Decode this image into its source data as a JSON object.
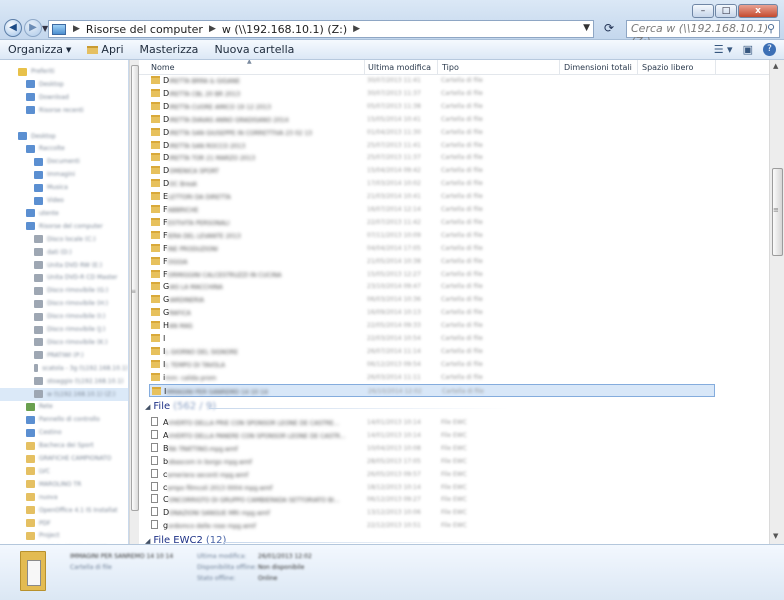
{
  "window": {
    "controls": [
      "–",
      "□",
      "x"
    ]
  },
  "address": {
    "crumbs": [
      "Risorse del computer",
      "w (\\\\192.168.10.1) (Z:)"
    ]
  },
  "search": {
    "placeholder": "Cerca w (\\\\192.168.10.1) (Z:)"
  },
  "toolbar": {
    "organize": "Organizza",
    "open": "Apri",
    "burn": "Masterizza",
    "new_folder": "Nuova cartella"
  },
  "columns": {
    "name": "Nome",
    "modified": "Ultima modifica",
    "type": "Tipo",
    "total_size": "Dimensioni totali",
    "free_space": "Spazio libero"
  },
  "navpane": {
    "items": [
      {
        "label": "Preferiti",
        "icon": "star-icon",
        "indent": 0
      },
      {
        "label": "Desktop",
        "icon": "desktop-icon",
        "indent": 1
      },
      {
        "label": "Download",
        "icon": "download-icon",
        "indent": 1
      },
      {
        "label": "Risorse recenti",
        "icon": "recent-icon",
        "indent": 1
      },
      {
        "label": "",
        "icon": "",
        "indent": 0
      },
      {
        "label": "Desktop",
        "icon": "desktop-icon",
        "indent": 0
      },
      {
        "label": "Raccolte",
        "icon": "library-icon",
        "indent": 1
      },
      {
        "label": "Documenti",
        "icon": "documents-icon",
        "indent": 2
      },
      {
        "label": "Immagini",
        "icon": "pictures-icon",
        "indent": 2
      },
      {
        "label": "Musica",
        "icon": "music-icon",
        "indent": 2
      },
      {
        "label": "Video",
        "icon": "video-icon",
        "indent": 2
      },
      {
        "label": "utente",
        "icon": "user-icon",
        "indent": 1
      },
      {
        "label": "Risorse del computer",
        "icon": "computer-icon",
        "indent": 1
      },
      {
        "label": "Disco locale (C:)",
        "icon": "drive-icon",
        "indent": 2
      },
      {
        "label": "dati (D:)",
        "icon": "drive-icon",
        "indent": 2
      },
      {
        "label": "Unita DVD RW (E:)",
        "icon": "drive-icon",
        "indent": 2
      },
      {
        "label": "Unita DVD-R CD Master",
        "icon": "drive-icon",
        "indent": 2
      },
      {
        "label": "Disco rimovibile (G:)",
        "icon": "drive-icon",
        "indent": 2
      },
      {
        "label": "Disco rimovibile (H:)",
        "icon": "drive-icon",
        "indent": 2
      },
      {
        "label": "Disco rimovibile (I:)",
        "icon": "drive-icon",
        "indent": 2
      },
      {
        "label": "Disco rimovibile (J:)",
        "icon": "drive-icon",
        "indent": 2
      },
      {
        "label": "Disco rimovibile (K:)",
        "icon": "drive-icon",
        "indent": 2
      },
      {
        "label": "PRATIWI (P:)",
        "icon": "drive-icon",
        "indent": 2
      },
      {
        "label": "scatola - 3g (\\\\192.168.10.1)",
        "icon": "net-drive-icon",
        "indent": 2
      },
      {
        "label": "stoaggio (\\\\192.168.10.1)",
        "icon": "net-drive-icon",
        "indent": 2
      },
      {
        "label": "w (\\\\192.168.10.1) (Z:)",
        "icon": "net-drive-icon",
        "indent": 2,
        "selected": true
      },
      {
        "label": "Rete",
        "icon": "network-icon",
        "indent": 1
      },
      {
        "label": "Pannello di controllo",
        "icon": "control-panel-icon",
        "indent": 1
      },
      {
        "label": "Cestino",
        "icon": "recycle-bin-icon",
        "indent": 1
      },
      {
        "label": "Bacheca dei Sport",
        "icon": "folder-icon",
        "indent": 1
      },
      {
        "label": "GRAFICHE CAMPIONATO",
        "icon": "folder-icon",
        "indent": 1
      },
      {
        "label": "LVC",
        "icon": "folder-icon",
        "indent": 1
      },
      {
        "label": "MAROLINO TR",
        "icon": "folder-icon",
        "indent": 1
      },
      {
        "label": "nuova",
        "icon": "folder-icon",
        "indent": 1
      },
      {
        "label": "OpenOffice 4.1 IS Installat",
        "icon": "folder-icon",
        "indent": 1
      },
      {
        "label": "PDF",
        "icon": "folder-icon",
        "indent": 1
      },
      {
        "label": "Project",
        "icon": "folder-icon",
        "indent": 1
      },
      {
        "label": "SEGNALAZIONI CORSE",
        "icon": "folder-icon",
        "indent": 1
      }
    ]
  },
  "folders": [
    {
      "first": "D",
      "rest": "IRETTA BRRA & GIGANE",
      "date": "30/07/2013 11:41",
      "type": "Cartella di file"
    },
    {
      "first": "D",
      "rest": "IRETTA CBL 20 BR 2013",
      "date": "30/07/2013 11:37",
      "type": "Cartella di file"
    },
    {
      "first": "D",
      "rest": "IRETTA CUORE AMICO 19 12 2013",
      "date": "05/07/2013 11:38",
      "type": "Cartella di file"
    },
    {
      "first": "D",
      "rest": "IRETTA DIAVAS ANNO GRADISANO 2014",
      "date": "15/05/2014 10:41",
      "type": "Cartella di file"
    },
    {
      "first": "D",
      "rest": "IRETTA SAN GIUSEPPE IN CORRETTIVA 23 02 13",
      "date": "01/04/2013 11:30",
      "type": "Cartella di file"
    },
    {
      "first": "D",
      "rest": "IRETTA SAN ROCCO 2013",
      "date": "25/07/2013 11:41",
      "type": "Cartella di file"
    },
    {
      "first": "D",
      "rest": "IRETTA TOR 21 MARZO 2013",
      "date": "25/07/2013 11:37",
      "type": "Cartella di file"
    },
    {
      "first": "D",
      "rest": "OMENICA SPORT",
      "date": "15/04/2014 09:42",
      "type": "Cartella di file"
    },
    {
      "first": "D",
      "rest": "OC Break",
      "date": "17/03/2014 10:02",
      "type": "Cartella di file"
    },
    {
      "first": "E",
      "rest": "LETTORI DA DIRETTA",
      "date": "21/03/2014 10:41",
      "type": "Cartella di file"
    },
    {
      "first": "F",
      "rest": "ABBRICHE",
      "date": "16/07/2014 12:14",
      "type": "Cartella di file"
    },
    {
      "first": "F",
      "rest": "ESTIVITA PERSONALI",
      "date": "22/07/2013 11:42",
      "type": "Cartella di file"
    },
    {
      "first": "F",
      "rest": "IERA DEL LEVANTE 2013",
      "date": "07/11/2013 10:09",
      "type": "Cartella di file"
    },
    {
      "first": "F",
      "rest": "INE PRODUZIONI",
      "date": "04/04/2014 17:05",
      "type": "Cartella di file"
    },
    {
      "first": "F",
      "rest": "OGGIA",
      "date": "21/05/2014 10:38",
      "type": "Cartella di file"
    },
    {
      "first": "F",
      "rest": "ORMIGGINI CALCESTRUZZI IN CUCINA",
      "date": "15/05/2013 12:27",
      "type": "Cartella di file"
    },
    {
      "first": "G",
      "rest": "IAS LA MACCHINA",
      "date": "23/10/2014 09:47",
      "type": "Cartella di file"
    },
    {
      "first": "G",
      "rest": "IARDINERIA",
      "date": "06/03/2014 10:36",
      "type": "Cartella di file"
    },
    {
      "first": "G",
      "rest": "RAFICA",
      "date": "16/09/2014 10:13",
      "type": "Cartella di file"
    },
    {
      "first": "H",
      "rest": "AN MAS",
      "date": "22/05/2014 09:33",
      "type": "Cartella di file"
    },
    {
      "first": "I",
      "rest": "",
      "date": "22/03/2014 10:54",
      "type": "Cartella di file"
    },
    {
      "first": "I",
      "rest": "L GIORNO DEL SIGNORE",
      "date": "26/07/2014 11:14",
      "type": "Cartella di file"
    },
    {
      "first": "I",
      "rest": "L TEMPO DI TAVOLA",
      "date": "06/12/2013 09:54",
      "type": "Cartella di file"
    },
    {
      "first": "i",
      "rest": "mm: calida prom",
      "date": "26/03/2014 11:11",
      "type": "Cartella di file"
    },
    {
      "first": "I",
      "rest": "MMAGINI PER SANREMO 14 10 14",
      "date": "26/10/2014 12:02",
      "type": "Cartella di file",
      "selected": true
    }
  ],
  "group_file": {
    "label": "File",
    "count": "(562 / 9)"
  },
  "files": [
    {
      "first": "A",
      "rest": "VVERTO DELLA PRIE CON SPONSOR LEONE DE CASTRE...",
      "date": "14/01/2013 10:14",
      "type": "File EWC"
    },
    {
      "first": "A",
      "rest": "VVERTO DELLA PANERE CON SPONSOR LEONE DE CASTR...",
      "date": "14/01/2013 10:14",
      "type": "File EWC"
    },
    {
      "first": "B",
      "rest": "RA TRATTINO.mpg.wmf",
      "date": "10/04/2013 10:08",
      "type": "File EWC"
    },
    {
      "first": "b",
      "rest": "obascom in borgo mpg.wmf",
      "date": "28/05/2013 17:05",
      "type": "File EWC"
    },
    {
      "first": "c",
      "rest": "ameriera seconti mpg.wmf",
      "date": "26/05/2013 09:57",
      "type": "File EWC"
    },
    {
      "first": "c",
      "rest": "ampo filmcoli 2013 0004 mpg.wmf",
      "date": "18/12/2013 10:14",
      "type": "File EWC"
    },
    {
      "first": "C",
      "rest": "ONCORRIGTO DI GRUPPO CAMBIERADA SETTORIATO BI...",
      "date": "06/12/2013 09:27",
      "type": "File EWC"
    },
    {
      "first": "D",
      "rest": "ONAZIONI SANGUE MRI mpg.wmf",
      "date": "13/12/2013 10:06",
      "type": "File EWC"
    },
    {
      "first": "g",
      "rest": "ordomco delle rose mpg.wmf",
      "date": "22/12/2013 10:51",
      "type": "File EWC"
    }
  ],
  "group_ewc2": {
    "label": "File EWC2",
    "count": "(12)"
  },
  "details": {
    "name": "IMMAGINI PER SANREMO 14 10 14",
    "kind": "Cartella di file",
    "rows": [
      {
        "k": "Ultima modifica:",
        "v": "26/01/2013 12:02"
      },
      {
        "k": "Disponibilita offline:",
        "v": "Non disponibile"
      },
      {
        "k": "Stato offline:",
        "v": "Online"
      }
    ]
  }
}
